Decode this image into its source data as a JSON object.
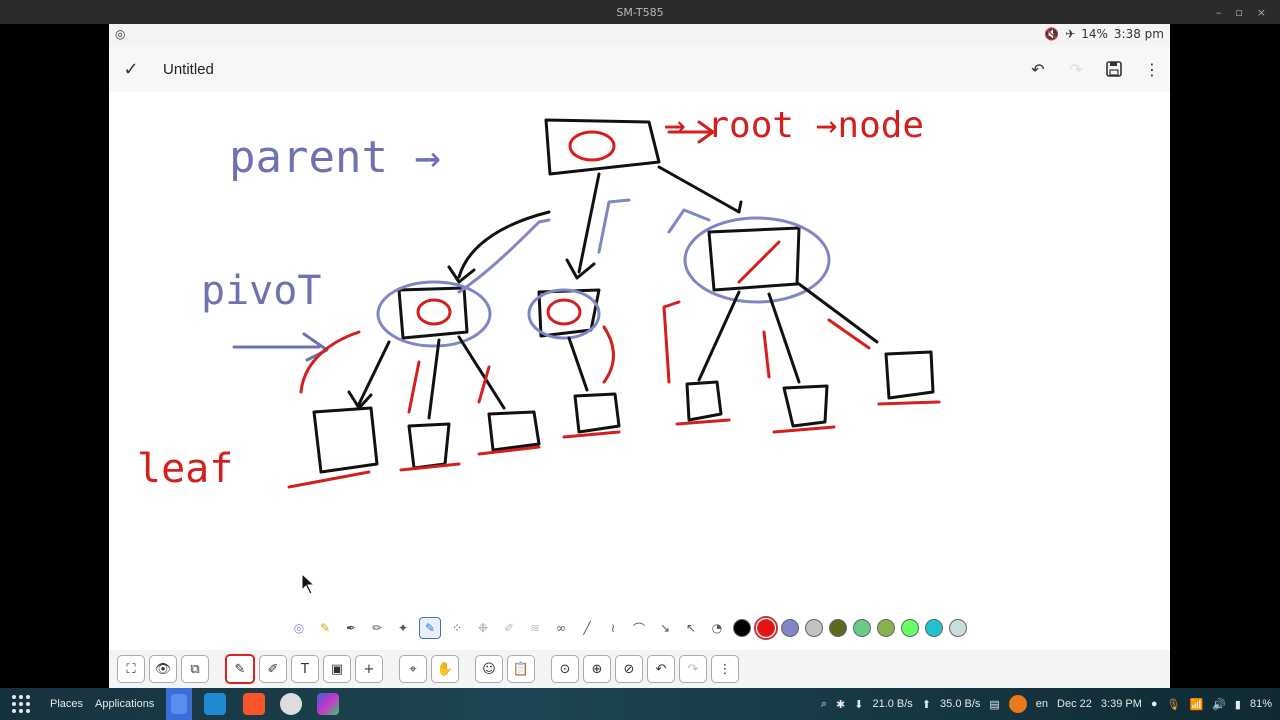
{
  "window": {
    "title": "SM-T585",
    "controls": [
      "–",
      "▫",
      "×"
    ]
  },
  "statusbar": {
    "left_icon": "◎",
    "battery": "14%",
    "time": "3:38 pm"
  },
  "appbar": {
    "title": "Untitled",
    "check": "✓",
    "undo": "↶",
    "save": "💾",
    "more": "⋮"
  },
  "canvas_text": {
    "parent": "parent →",
    "root_node": "→ root →node",
    "pivot": "pivoT",
    "leaf": "leaf"
  },
  "penbar": {
    "colors": [
      "#000000",
      "#ee1111",
      "#7f86c4",
      "#c2c2c2",
      "#5a6a1f",
      "#66cc88",
      "#88b04b",
      "#66ff66",
      "#22c2cc",
      "#c8dede"
    ],
    "selected_color": "#ee1111"
  },
  "toolbar": {
    "tools": [
      "⛶",
      "👁",
      "⧉",
      "✎",
      "✐",
      "T",
      "▣",
      "+",
      "⌖",
      "✋",
      "☺",
      "📋",
      "⊙",
      "⊕",
      "⊘",
      "↶",
      "↷",
      "⋮"
    ]
  },
  "taskbar": {
    "places": "Places",
    "applications": "Applications",
    "net_down": "21.0 B/s",
    "net_up": "35.0 B/s",
    "lang": "en",
    "date": "Dec 22",
    "time": "3:39 PM",
    "battery": "81%"
  }
}
